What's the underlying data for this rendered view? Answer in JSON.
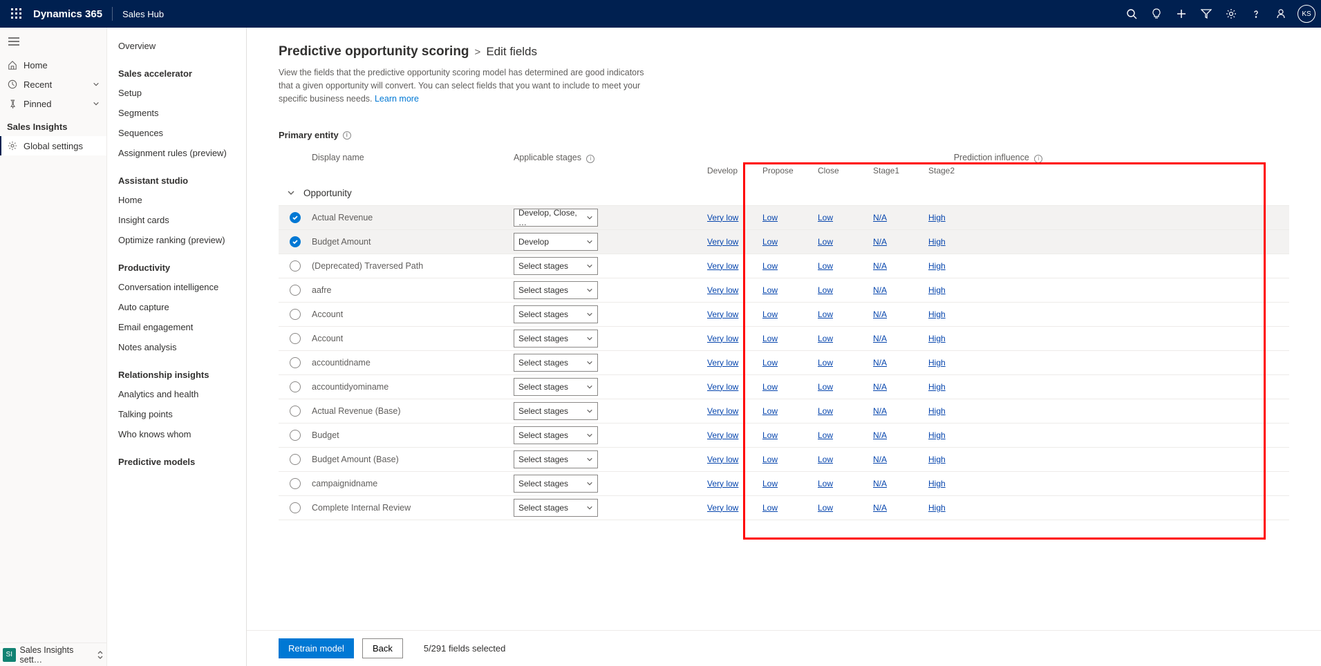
{
  "topbar": {
    "brand": "Dynamics 365",
    "app": "Sales Hub",
    "avatar": "KS"
  },
  "nav1": {
    "items": [
      {
        "icon": "home",
        "label": "Home"
      },
      {
        "icon": "clock",
        "label": "Recent",
        "expandable": true
      },
      {
        "icon": "pin",
        "label": "Pinned",
        "expandable": true
      }
    ],
    "section": "Sales Insights",
    "globalSettings": "Global settings",
    "bottom": {
      "sq": "SI",
      "label": "Sales Insights sett…"
    }
  },
  "nav2": {
    "groups": [
      {
        "head": null,
        "items": [
          "Overview"
        ]
      },
      {
        "head": "Sales accelerator",
        "items": [
          "Setup",
          "Segments",
          "Sequences",
          "Assignment rules (preview)"
        ]
      },
      {
        "head": "Assistant studio",
        "items": [
          "Home",
          "Insight cards",
          "Optimize ranking (preview)"
        ]
      },
      {
        "head": "Productivity",
        "items": [
          "Conversation intelligence",
          "Auto capture",
          "Email engagement",
          "Notes analysis"
        ]
      },
      {
        "head": "Relationship insights",
        "items": [
          "Analytics and health",
          "Talking points",
          "Who knows whom"
        ]
      },
      {
        "head": "Predictive models",
        "items": []
      }
    ]
  },
  "main": {
    "crumb1": "Predictive opportunity scoring",
    "crumbSep": ">",
    "crumb2": "Edit fields",
    "desc": "View the fields that the predictive opportunity scoring model has determined are good indicators that a given opportunity will convert. You can select fields that you want to include to meet your specific business needs. ",
    "learn": "Learn more",
    "primary": "Primary entity",
    "columns": {
      "displayName": "Display name",
      "applicable": "Applicable stages",
      "influence": "Prediction influence",
      "stages": [
        "Develop",
        "Propose",
        "Close",
        "Stage1",
        "Stage2"
      ]
    },
    "group": "Opportunity",
    "rows": [
      {
        "checked": true,
        "name": "Actual Revenue",
        "stage": "Develop, Close, …",
        "inf": [
          "Very low",
          "Low",
          "Low",
          "N/A",
          "High"
        ]
      },
      {
        "checked": true,
        "name": "Budget Amount",
        "stage": "Develop",
        "inf": [
          "Very low",
          "Low",
          "Low",
          "N/A",
          "High"
        ]
      },
      {
        "checked": false,
        "name": "(Deprecated) Traversed Path",
        "stage": "Select stages",
        "inf": [
          "Very low",
          "Low",
          "Low",
          "N/A",
          "High"
        ]
      },
      {
        "checked": false,
        "name": "aafre",
        "stage": "Select stages",
        "inf": [
          "Very low",
          "Low",
          "Low",
          "N/A",
          "High"
        ]
      },
      {
        "checked": false,
        "name": "Account",
        "stage": "Select stages",
        "inf": [
          "Very low",
          "Low",
          "Low",
          "N/A",
          "High"
        ]
      },
      {
        "checked": false,
        "name": "Account",
        "stage": "Select stages",
        "inf": [
          "Very low",
          "Low",
          "Low",
          "N/A",
          "High"
        ]
      },
      {
        "checked": false,
        "name": "accountidname",
        "stage": "Select stages",
        "inf": [
          "Very low",
          "Low",
          "Low",
          "N/A",
          "High"
        ]
      },
      {
        "checked": false,
        "name": "accountidyominame",
        "stage": "Select stages",
        "inf": [
          "Very low",
          "Low",
          "Low",
          "N/A",
          "High"
        ]
      },
      {
        "checked": false,
        "name": "Actual Revenue (Base)",
        "stage": "Select stages",
        "inf": [
          "Very low",
          "Low",
          "Low",
          "N/A",
          "High"
        ]
      },
      {
        "checked": false,
        "name": "Budget",
        "stage": "Select stages",
        "inf": [
          "Very low",
          "Low",
          "Low",
          "N/A",
          "High"
        ]
      },
      {
        "checked": false,
        "name": "Budget Amount (Base)",
        "stage": "Select stages",
        "inf": [
          "Very low",
          "Low",
          "Low",
          "N/A",
          "High"
        ]
      },
      {
        "checked": false,
        "name": "campaignidname",
        "stage": "Select stages",
        "inf": [
          "Very low",
          "Low",
          "Low",
          "N/A",
          "High"
        ]
      },
      {
        "checked": false,
        "name": "Complete Internal Review",
        "stage": "Select stages",
        "inf": [
          "Very low",
          "Low",
          "Low",
          "N/A",
          "High"
        ]
      }
    ]
  },
  "footer": {
    "retrain": "Retrain model",
    "back": "Back",
    "status": "5/291 fields selected"
  }
}
